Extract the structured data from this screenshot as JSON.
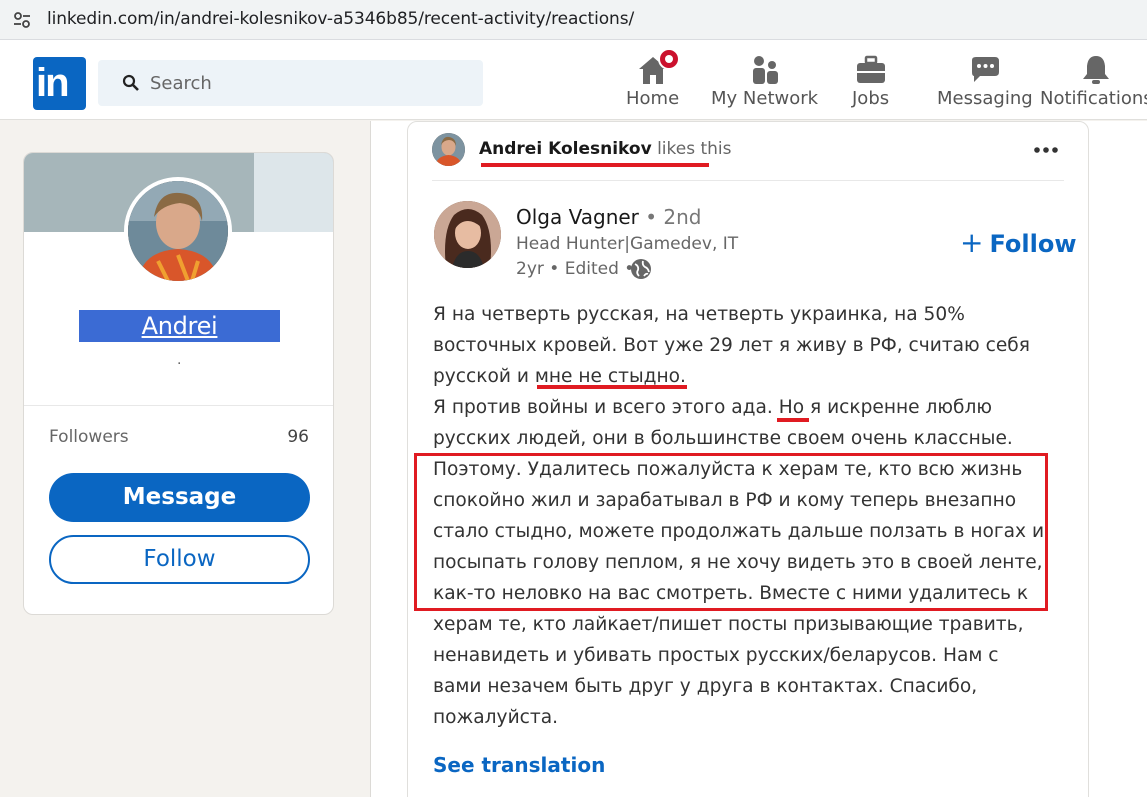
{
  "browser": {
    "url": "linkedin.com/in/andrei-kolesnikov-a5346b85/recent-activity/reactions/"
  },
  "nav": {
    "logo_text": "in",
    "search_placeholder": "Search",
    "items": [
      {
        "label": "Home",
        "icon": "home-icon"
      },
      {
        "label": "My Network",
        "icon": "network-icon"
      },
      {
        "label": "Jobs",
        "icon": "briefcase-icon"
      },
      {
        "label": "Messaging",
        "icon": "messaging-icon"
      },
      {
        "label": "Notifications",
        "icon": "bell-icon"
      }
    ]
  },
  "profile": {
    "name": "Andrei Kolesnikov",
    "headline": ".",
    "followers_label": "Followers",
    "followers_count": "96",
    "message_label": "Message",
    "follow_label": "Follow"
  },
  "activity": {
    "actor": "Andrei Kolesnikov",
    "verb": "likes this"
  },
  "post": {
    "author_name": "Olga Vagner",
    "author_degree": "• 2nd",
    "author_headline": "Head Hunter|Gamedev, IT",
    "meta": "2yr • Edited •",
    "follow_label": "Follow",
    "follow_plus": "+",
    "lines": [
      "Я на четверть русская, на четверть украинка, на 50%",
      "восточных кровей. Вот уже 29 лет я живу в РФ, считаю себя",
      "русской и мне не стыдно.",
      "Я против войны и всего этого ада. Но я искренне люблю",
      "русских людей, они в большинстве своем очень классные.",
      "Поэтому. Удалитесь пожалуйста к херам те, кто всю жизнь",
      "спокойно жил и зарабатывал в РФ и кому теперь внезапно",
      "стало стыдно, можете продолжать дальше ползать в ногах и",
      "посыпать голову пеплом, я не хочу видеть это в своей ленте,",
      "как-то неловко на вас смотреть. Вместе с ними удалитесь к",
      "херам те, кто лайкает/пишет посты призывающие травить,",
      "ненавидеть и убивать простых русских/беларусов. Нам с",
      "вами незачем быть друг у друга в контактах. Спасибо,",
      "пожалуйста."
    ],
    "see_translation": "See translation"
  },
  "colors": {
    "brand": "#0a66c2",
    "annotation_red": "#e01b22"
  }
}
